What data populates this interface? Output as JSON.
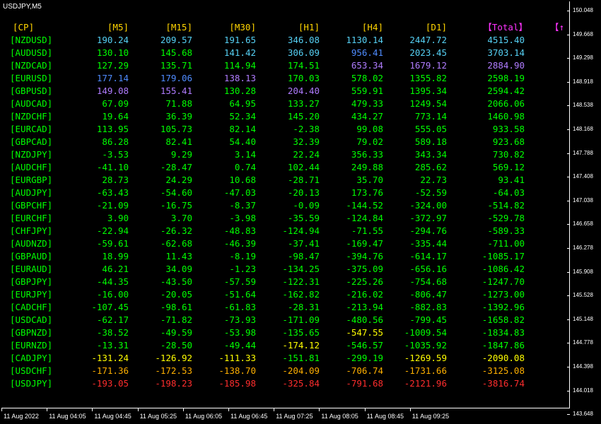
{
  "window": {
    "symbol": "USDJPY,M5"
  },
  "colors": {
    "cyan": "#56D1F5",
    "blue": "#4F8CFF",
    "violet": "#B07CFF",
    "lime": "#00FF00",
    "yellow": "#FFFF00",
    "orange": "#FFB000",
    "red": "#FF2D2D",
    "magenta": "#FF33FF",
    "header": "#FFD400",
    "pair": "#00FF00"
  },
  "table": {
    "headers": [
      "[CP]",
      "[M5]",
      "[M15]",
      "[M30]",
      "[H1]",
      "[H4]",
      "[D1]",
      "【Total】",
      "【↑"
    ],
    "rows": [
      {
        "pair": "[NZDUSD]",
        "values": [
          "190.24",
          "209.57",
          "191.65",
          "346.08",
          "1130.14",
          "2447.72",
          "4515.40"
        ],
        "colors": [
          "cyan",
          "cyan",
          "cyan",
          "cyan",
          "cyan",
          "cyan",
          "cyan"
        ]
      },
      {
        "pair": "[AUDUSD]",
        "values": [
          "130.10",
          "145.68",
          "141.42",
          "306.09",
          "956.41",
          "2023.45",
          "3703.14"
        ],
        "colors": [
          "lime",
          "lime",
          "cyan",
          "cyan",
          "blue",
          "cyan",
          "cyan"
        ]
      },
      {
        "pair": "[NZDCAD]",
        "values": [
          "127.29",
          "135.71",
          "114.94",
          "174.51",
          "653.34",
          "1679.12",
          "2884.90"
        ],
        "colors": [
          "lime",
          "lime",
          "lime",
          "lime",
          "violet",
          "violet",
          "violet"
        ]
      },
      {
        "pair": "[EURUSD]",
        "values": [
          "177.14",
          "179.06",
          "138.13",
          "170.03",
          "578.02",
          "1355.82",
          "2598.19"
        ],
        "colors": [
          "blue",
          "blue",
          "violet",
          "lime",
          "lime",
          "lime",
          "lime"
        ]
      },
      {
        "pair": "[GBPUSD]",
        "values": [
          "149.08",
          "155.41",
          "130.28",
          "204.40",
          "559.91",
          "1395.34",
          "2594.42"
        ],
        "colors": [
          "violet",
          "violet",
          "lime",
          "violet",
          "lime",
          "lime",
          "lime"
        ]
      },
      {
        "pair": "[AUDCAD]",
        "values": [
          "67.09",
          "71.88",
          "64.95",
          "133.27",
          "479.33",
          "1249.54",
          "2066.06"
        ],
        "colors": [
          "lime",
          "lime",
          "lime",
          "lime",
          "lime",
          "lime",
          "lime"
        ]
      },
      {
        "pair": "[NZDCHF]",
        "values": [
          "19.64",
          "36.39",
          "52.34",
          "145.20",
          "434.27",
          "773.14",
          "1460.98"
        ],
        "colors": [
          "lime",
          "lime",
          "lime",
          "lime",
          "lime",
          "lime",
          "lime"
        ]
      },
      {
        "pair": "[EURCAD]",
        "values": [
          "113.95",
          "105.73",
          "82.14",
          "-2.38",
          "99.08",
          "555.05",
          "933.58"
        ],
        "colors": [
          "lime",
          "lime",
          "lime",
          "lime",
          "lime",
          "lime",
          "lime"
        ]
      },
      {
        "pair": "[GBPCAD]",
        "values": [
          "86.28",
          "82.41",
          "54.40",
          "32.39",
          "79.02",
          "589.18",
          "923.68"
        ],
        "colors": [
          "lime",
          "lime",
          "lime",
          "lime",
          "lime",
          "lime",
          "lime"
        ]
      },
      {
        "pair": "[NZDJPY]",
        "values": [
          "-3.53",
          "9.29",
          "3.14",
          "22.24",
          "356.33",
          "343.34",
          "730.82"
        ],
        "colors": [
          "lime",
          "lime",
          "lime",
          "lime",
          "lime",
          "lime",
          "lime"
        ]
      },
      {
        "pair": "[AUDCHF]",
        "values": [
          "-41.10",
          "-28.47",
          "0.74",
          "102.44",
          "249.88",
          "285.62",
          "569.12"
        ],
        "colors": [
          "lime",
          "lime",
          "lime",
          "lime",
          "lime",
          "lime",
          "lime"
        ]
      },
      {
        "pair": "[EURGBP]",
        "values": [
          "28.73",
          "24.29",
          "10.68",
          "-28.71",
          "35.70",
          "22.73",
          "93.41"
        ],
        "colors": [
          "lime",
          "lime",
          "lime",
          "lime",
          "lime",
          "lime",
          "lime"
        ]
      },
      {
        "pair": "[AUDJPY]",
        "values": [
          "-63.43",
          "-54.60",
          "-47.03",
          "-20.13",
          "173.76",
          "-52.59",
          "-64.03"
        ],
        "colors": [
          "lime",
          "lime",
          "lime",
          "lime",
          "lime",
          "lime",
          "lime"
        ]
      },
      {
        "pair": "[GBPCHF]",
        "values": [
          "-21.09",
          "-16.75",
          "-8.37",
          "-0.09",
          "-144.52",
          "-324.00",
          "-514.82"
        ],
        "colors": [
          "lime",
          "lime",
          "lime",
          "lime",
          "lime",
          "lime",
          "lime"
        ]
      },
      {
        "pair": "[EURCHF]",
        "values": [
          "3.90",
          "3.70",
          "-3.98",
          "-35.59",
          "-124.84",
          "-372.97",
          "-529.78"
        ],
        "colors": [
          "lime",
          "lime",
          "lime",
          "lime",
          "lime",
          "lime",
          "lime"
        ]
      },
      {
        "pair": "[CHFJPY]",
        "values": [
          "-22.94",
          "-26.32",
          "-48.83",
          "-124.94",
          "-71.55",
          "-294.76",
          "-589.33"
        ],
        "colors": [
          "lime",
          "lime",
          "lime",
          "lime",
          "lime",
          "lime",
          "lime"
        ]
      },
      {
        "pair": "[AUDNZD]",
        "values": [
          "-59.61",
          "-62.68",
          "-46.39",
          "-37.41",
          "-169.47",
          "-335.44",
          "-711.00"
        ],
        "colors": [
          "lime",
          "lime",
          "lime",
          "lime",
          "lime",
          "lime",
          "lime"
        ]
      },
      {
        "pair": "[GBPAUD]",
        "values": [
          "18.99",
          "11.43",
          "-8.19",
          "-98.47",
          "-394.76",
          "-614.17",
          "-1085.17"
        ],
        "colors": [
          "lime",
          "lime",
          "lime",
          "lime",
          "lime",
          "lime",
          "lime"
        ]
      },
      {
        "pair": "[EURAUD]",
        "values": [
          "46.21",
          "34.09",
          "-1.23",
          "-134.25",
          "-375.09",
          "-656.16",
          "-1086.42"
        ],
        "colors": [
          "lime",
          "lime",
          "lime",
          "lime",
          "lime",
          "lime",
          "lime"
        ]
      },
      {
        "pair": "[GBPJPY]",
        "values": [
          "-44.35",
          "-43.50",
          "-57.59",
          "-122.31",
          "-225.26",
          "-754.68",
          "-1247.70"
        ],
        "colors": [
          "lime",
          "lime",
          "lime",
          "lime",
          "lime",
          "lime",
          "lime"
        ]
      },
      {
        "pair": "[EURJPY]",
        "values": [
          "-16.00",
          "-20.05",
          "-51.64",
          "-162.82",
          "-216.02",
          "-806.47",
          "-1273.00"
        ],
        "colors": [
          "lime",
          "lime",
          "lime",
          "lime",
          "lime",
          "lime",
          "lime"
        ]
      },
      {
        "pair": "[CADCHF]",
        "values": [
          "-107.45",
          "-98.61",
          "-61.83",
          "-28.31",
          "-213.94",
          "-882.83",
          "-1392.96"
        ],
        "colors": [
          "lime",
          "lime",
          "lime",
          "lime",
          "lime",
          "lime",
          "lime"
        ]
      },
      {
        "pair": "[USDCAD]",
        "values": [
          "-62.17",
          "-71.82",
          "-73.93",
          "-171.09",
          "-480.56",
          "-799.45",
          "-1658.82"
        ],
        "colors": [
          "lime",
          "lime",
          "lime",
          "lime",
          "lime",
          "lime",
          "lime"
        ]
      },
      {
        "pair": "[GBPNZD]",
        "values": [
          "-38.52",
          "-49.59",
          "-53.98",
          "-135.65",
          "-547.55",
          "-1009.54",
          "-1834.83"
        ],
        "colors": [
          "lime",
          "lime",
          "lime",
          "lime",
          "yellow",
          "lime",
          "lime"
        ]
      },
      {
        "pair": "[EURNZD]",
        "values": [
          "-13.31",
          "-28.50",
          "-49.44",
          "-174.12",
          "-546.57",
          "-1035.92",
          "-1847.86"
        ],
        "colors": [
          "lime",
          "lime",
          "lime",
          "yellow",
          "lime",
          "lime",
          "lime"
        ]
      },
      {
        "pair": "[CADJPY]",
        "values": [
          "-131.24",
          "-126.92",
          "-111.33",
          "-151.81",
          "-299.19",
          "-1269.59",
          "-2090.08"
        ],
        "colors": [
          "yellow",
          "yellow",
          "yellow",
          "lime",
          "lime",
          "yellow",
          "yellow"
        ]
      },
      {
        "pair": "[USDCHF]",
        "values": [
          "-171.36",
          "-172.53",
          "-138.70",
          "-204.09",
          "-706.74",
          "-1731.66",
          "-3125.08"
        ],
        "colors": [
          "orange",
          "orange",
          "orange",
          "orange",
          "orange",
          "orange",
          "orange"
        ]
      },
      {
        "pair": "[USDJPY]",
        "values": [
          "-193.05",
          "-198.23",
          "-185.98",
          "-325.84",
          "-791.68",
          "-2121.96",
          "-3816.74"
        ],
        "colors": [
          "red",
          "red",
          "red",
          "red",
          "red",
          "red",
          "red"
        ]
      }
    ]
  },
  "price_axis": [
    "150.048",
    "149.668",
    "149.298",
    "148.918",
    "148.538",
    "148.168",
    "147.788",
    "147.408",
    "147.038",
    "146.658",
    "146.278",
    "145.908",
    "145.528",
    "145.148",
    "144.778",
    "144.398",
    "144.018",
    "143.648"
  ],
  "time_axis": [
    "11 Aug 2022",
    "11 Aug 04:05",
    "11 Aug 04:45",
    "11 Aug 05:25",
    "11 Aug 06:05",
    "11 Aug 06:45",
    "11 Aug 07:25",
    "11 Aug 08:05",
    "11 Aug 08:45",
    "11 Aug 09:25"
  ]
}
